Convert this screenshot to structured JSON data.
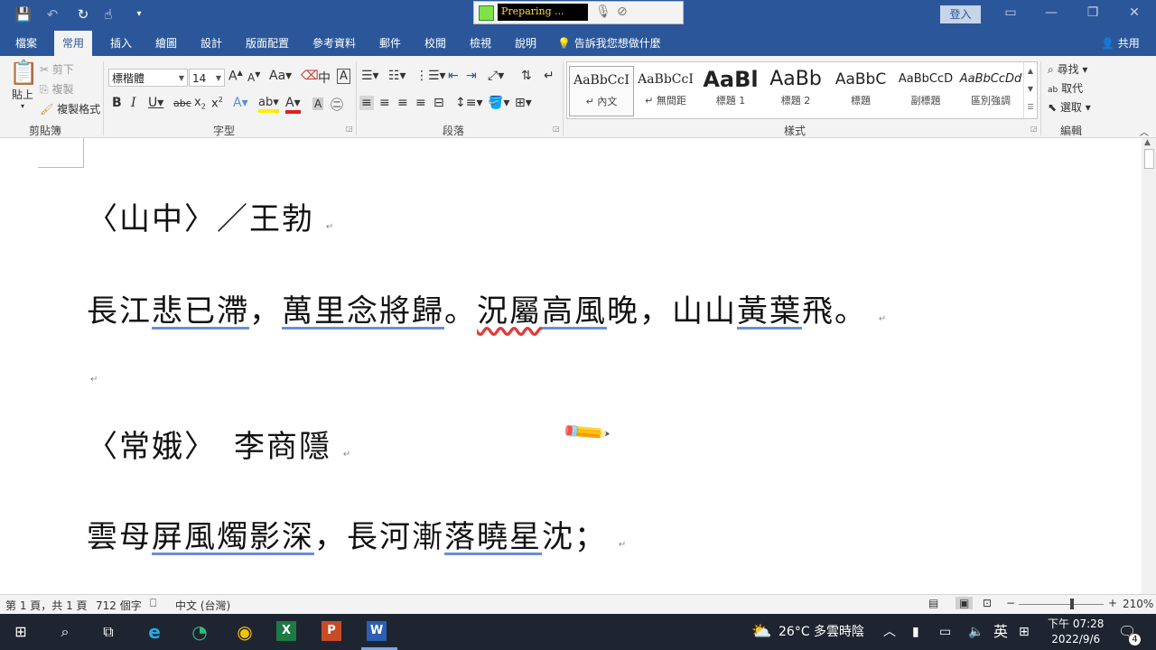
{
  "titlebar": {
    "signin": "登入",
    "recorder_status": "Preparing ..."
  },
  "tabs": [
    "檔案",
    "常用",
    "插入",
    "繪圖",
    "設計",
    "版面配置",
    "參考資料",
    "郵件",
    "校閱",
    "檢視",
    "說明"
  ],
  "tell_me": "告訴我您想做什麼",
  "share": "共用",
  "clipboard": {
    "paste": "貼上",
    "cut": "剪下",
    "copy": "複製",
    "format_painter": "複製格式",
    "label": "剪貼簿"
  },
  "font": {
    "name": "標楷體",
    "size": "14",
    "label": "字型"
  },
  "paragraph": {
    "label": "段落"
  },
  "styles": {
    "label": "樣式",
    "items": [
      {
        "preview": "AaBbCcI",
        "name": "↵ 內文"
      },
      {
        "preview": "AaBbCcI",
        "name": "↵ 無間距"
      },
      {
        "preview": "AaBl",
        "name": "標題 1"
      },
      {
        "preview": "AaBb",
        "name": "標題 2"
      },
      {
        "preview": "AaBbC",
        "name": "標題"
      },
      {
        "preview": "AaBbCcD",
        "name": "副標題"
      },
      {
        "preview": "AaBbCcDd",
        "name": "區別強調"
      }
    ]
  },
  "editing": {
    "find": "尋找",
    "replace": "取代",
    "select": "選取",
    "label": "編輯"
  },
  "document": {
    "line1": "〈山中〉／王勃",
    "line2_a": "長江",
    "line2_b": "悲已滯",
    "line2_c": "，",
    "line2_d": "萬里念將歸",
    "line2_e": "。",
    "line2_f": "況屬",
    "line2_g": "高風",
    "line2_h": "晚，山山",
    "line2_i": "黃葉",
    "line2_j": "飛。",
    "line3": "〈常娥〉　李商隱",
    "line4_a": "雲母",
    "line4_b": "屏風燭影深",
    "line4_c": "，長河漸",
    "line4_d": "落曉星",
    "line4_e": "沈；",
    "para_mark": "↵"
  },
  "status": {
    "page": "第 1 頁，共 1 頁",
    "words": "712 個字",
    "language": "中文 (台灣)",
    "zoom": "210%"
  },
  "taskbar": {
    "weather": "26°C 多雲時陰",
    "ime": "英",
    "time": "下午 07:28",
    "date": "2022/9/6",
    "notifications": "4"
  }
}
